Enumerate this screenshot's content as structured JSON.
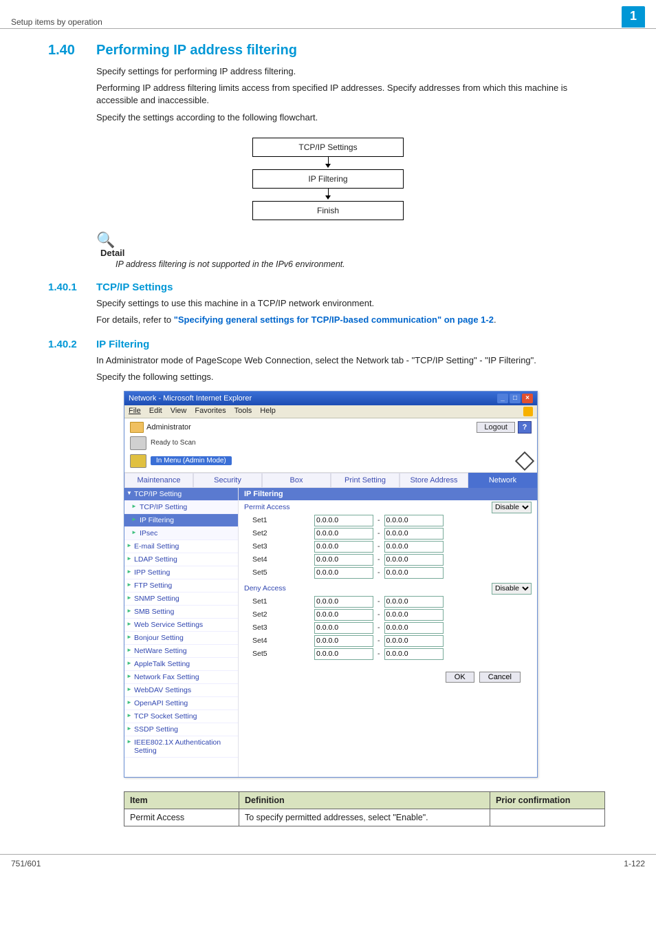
{
  "header": {
    "breadcrumb": "Setup items by operation",
    "chapter_badge": "1"
  },
  "section": {
    "number": "1.40",
    "title": "Performing IP address filtering",
    "para1": "Specify settings for performing IP address filtering.",
    "para2": "Performing IP address filtering limits access from specified IP addresses. Specify addresses from which this machine is accessible and inaccessible.",
    "para3": "Specify the settings according to the following flowchart."
  },
  "flowchart": {
    "box1": "TCP/IP Settings",
    "box2": "IP Filtering",
    "box3": "Finish"
  },
  "detail": {
    "label": "Detail",
    "text": "IP address filtering is not supported in the IPv6 environment."
  },
  "sub1": {
    "number": "1.40.1",
    "title": "TCP/IP Settings",
    "para1": "Specify settings to use this machine in a TCP/IP network environment.",
    "para2_prefix": "For details, refer to ",
    "para2_link": "\"Specifying general settings for TCP/IP-based communication\" on page 1-2",
    "para2_suffix": "."
  },
  "sub2": {
    "number": "1.40.2",
    "title": "IP Filtering",
    "para1": "In Administrator mode of PageScope Web Connection, select the Network tab - \"TCP/IP Setting\" - \"IP Filtering\".",
    "para2": "Specify the following settings."
  },
  "screenshot": {
    "window_title": "Network - Microsoft Internet Explorer",
    "menus": [
      "File",
      "Edit",
      "View",
      "Favorites",
      "Tools",
      "Help"
    ],
    "admin_label": "Administrator",
    "logout_label": "Logout",
    "help_label": "?",
    "ready_label": "Ready to Scan",
    "mode_label": "In Menu (Admin Mode)",
    "tabs": [
      "Maintenance",
      "Security",
      "Box",
      "Print Setting",
      "Store Address",
      "Network"
    ],
    "active_tab_index": 5,
    "sidebar": [
      {
        "label": "TCP/IP Setting",
        "type": "group"
      },
      {
        "label": "TCP/IP Setting",
        "type": "sub"
      },
      {
        "label": "IP Filtering",
        "type": "sub",
        "active": true
      },
      {
        "label": "IPsec",
        "type": "sub"
      },
      {
        "label": "E-mail Setting",
        "type": "item"
      },
      {
        "label": "LDAP Setting",
        "type": "item"
      },
      {
        "label": "IPP Setting",
        "type": "item"
      },
      {
        "label": "FTP Setting",
        "type": "item"
      },
      {
        "label": "SNMP Setting",
        "type": "item"
      },
      {
        "label": "SMB Setting",
        "type": "item"
      },
      {
        "label": "Web Service Settings",
        "type": "item"
      },
      {
        "label": "Bonjour Setting",
        "type": "item"
      },
      {
        "label": "NetWare Setting",
        "type": "item"
      },
      {
        "label": "AppleTalk Setting",
        "type": "item"
      },
      {
        "label": "Network Fax Setting",
        "type": "item"
      },
      {
        "label": "WebDAV Settings",
        "type": "item"
      },
      {
        "label": "OpenAPI Setting",
        "type": "item"
      },
      {
        "label": "TCP Socket Setting",
        "type": "item"
      },
      {
        "label": "SSDP Setting",
        "type": "item"
      },
      {
        "label": "IEEE802.1X Authentication Setting",
        "type": "item"
      }
    ],
    "panel_title": "IP Filtering",
    "permit_label": "Permit Access",
    "deny_label": "Deny Access",
    "disable_option": "Disable",
    "sets": [
      "Set1",
      "Set2",
      "Set3",
      "Set4",
      "Set5"
    ],
    "ip_value": "0.0.0.0",
    "ok_label": "OK",
    "cancel_label": "Cancel"
  },
  "table": {
    "headers": [
      "Item",
      "Definition",
      "Prior confirmation"
    ],
    "rows": [
      {
        "item": "Permit Access",
        "definition": "To specify permitted addresses, select \"Enable\".",
        "prior": ""
      }
    ]
  },
  "footer": {
    "left": "751/601",
    "right": "1-122"
  }
}
